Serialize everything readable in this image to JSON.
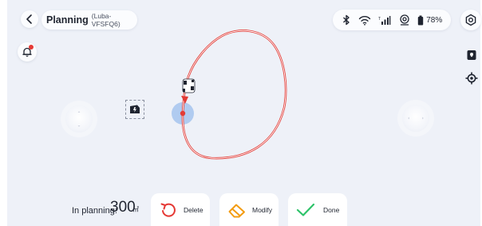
{
  "header": {
    "title": "Planning",
    "device": "(Luba-VFSFQ6)"
  },
  "status": {
    "battery": "78%"
  },
  "footer": {
    "planning_label": "In planning:",
    "planning_value": "300",
    "planning_unit": "㎡"
  },
  "actions": {
    "delete_label": "Delete",
    "modify_label": "Modify",
    "done_label": "Done"
  },
  "colors": {
    "path": "#e23b36",
    "start_marker": "#a9c6ee",
    "delete": "#e53935",
    "modify": "#f39c12",
    "done": "#2ec36a"
  }
}
